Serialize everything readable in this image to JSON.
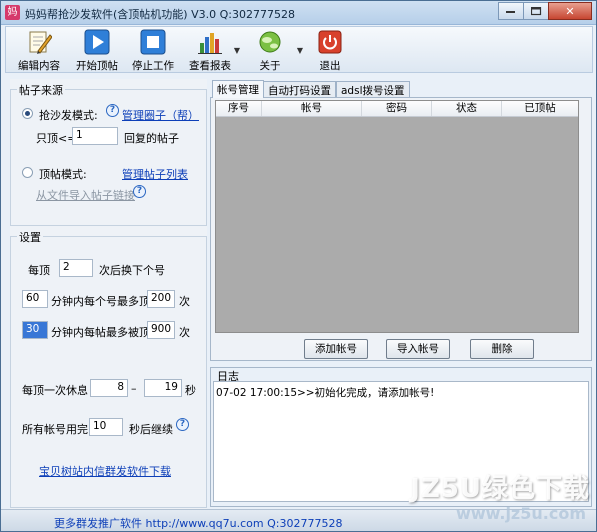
{
  "window": {
    "title": "妈妈帮抢沙发软件(含顶帖机功能) V3.0 Q:302777528",
    "icon_char": "妈",
    "controls": [
      "minimize-icon",
      "maximize-icon",
      "close-icon"
    ]
  },
  "toolbar": {
    "items": [
      {
        "label": "编辑内容",
        "icon": "edit-pencil-icon"
      },
      {
        "label": "开始顶帖",
        "icon": "play-icon"
      },
      {
        "label": "停止工作",
        "icon": "stop-icon"
      },
      {
        "label": "查看报表",
        "icon": "report-chart-icon"
      },
      {
        "label": "关于",
        "icon": "globe-leaf-icon"
      },
      {
        "label": "退出",
        "icon": "power-icon"
      }
    ]
  },
  "source_group": {
    "title": "帖子来源",
    "sofa_mode_label": "抢沙发模式:",
    "manage_circle_link": "管理圈子（帮）",
    "only_top_prefix": "只顶<=",
    "only_top_value": "1",
    "only_top_suffix": "回复的帖子",
    "top_mode_label": "顶帖模式:",
    "manage_posts_link": "管理帖子列表",
    "import_link": "从文件导入帖子链接"
  },
  "settings_group": {
    "title": "设置",
    "per_top_prefix": "每顶",
    "per_top_value": "2",
    "per_top_suffix": "次后换下个号",
    "min_per_account_value": "60",
    "min_per_account_mid": "分钟内每个号最多顶",
    "max_per_account_value": "200",
    "max_per_account_suffix": "次",
    "min_per_post_value": "30",
    "min_per_post_mid": "分钟内每帖最多被顶",
    "max_per_post_value": "900",
    "max_per_post_suffix": "次",
    "rest_label": "每顶一次休息",
    "rest_min": "8",
    "rest_dash": "–",
    "rest_max": "19",
    "rest_unit": "秒",
    "all_done_label": "所有帐号用完",
    "all_done_value": "10",
    "all_done_suffix": "秒后继续",
    "bottom_link": "宝贝树站内信群发软件下载"
  },
  "tabs": [
    {
      "label": "帐号管理",
      "active": true
    },
    {
      "label": "自动打码设置",
      "active": false
    },
    {
      "label": "adsl拨号设置",
      "active": false
    }
  ],
  "accounts_table": {
    "columns": [
      "序号",
      "帐号",
      "密码",
      "状态",
      "已顶帖"
    ],
    "rows": []
  },
  "buttons": {
    "add": "添加帐号",
    "import": "导入帐号",
    "delete": "删除"
  },
  "log": {
    "title": "日志",
    "lines": [
      "07-02 17:00:15>>初始化完成，请添加帐号!"
    ]
  },
  "status": {
    "text": "更多群发推广软件 http://www.qq7u.com Q:302777528"
  },
  "watermark": {
    "main": "JZ5U绿色下载",
    "sub": "www.jz5u.com"
  }
}
